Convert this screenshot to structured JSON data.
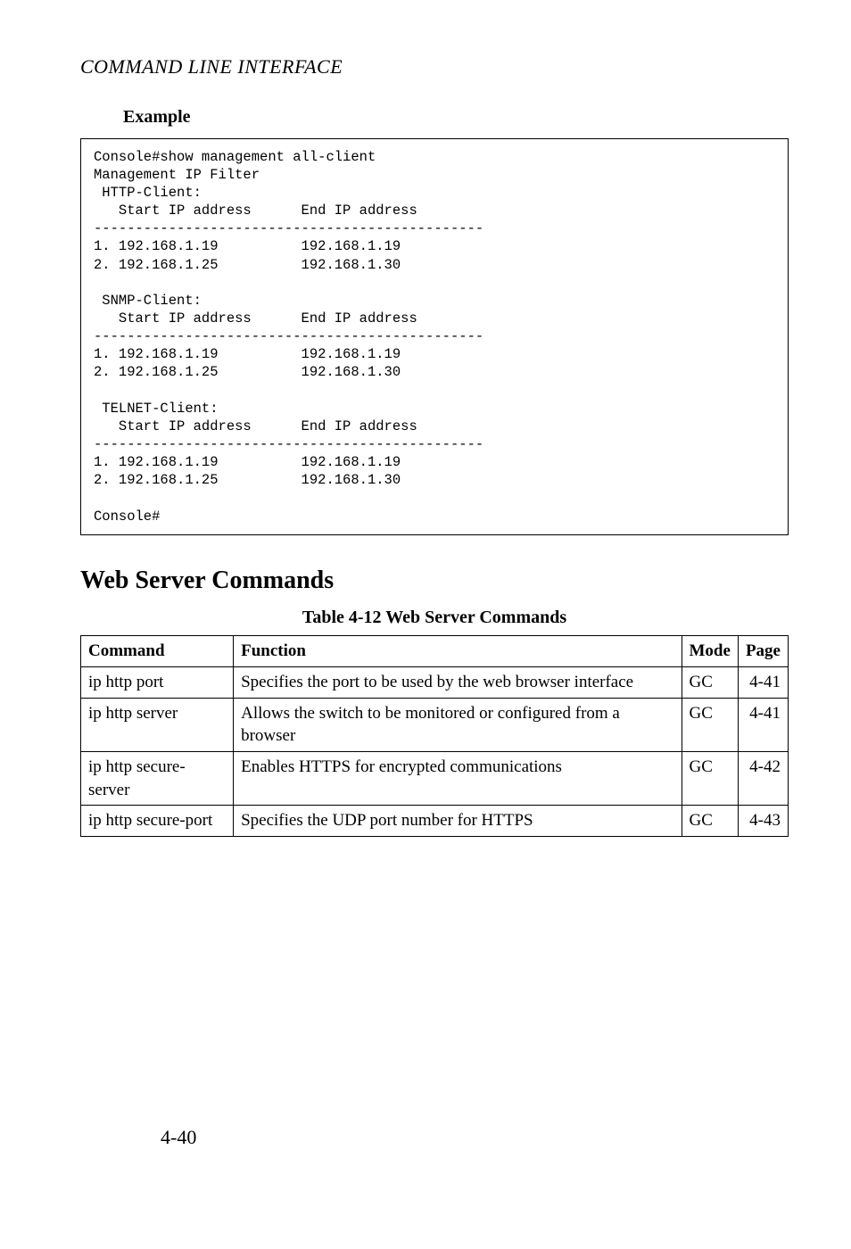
{
  "header": "COMMAND LINE INTERFACE",
  "example_label": "Example",
  "console": {
    "line1": "Console#show management all-client",
    "line2": "Management IP Filter",
    "http_client": " HTTP-Client:",
    "header_cols": "   Start IP address      End IP address",
    "rule": "-----------------------------------------------",
    "r1": "1. 192.168.1.19          192.168.1.19",
    "r2": "2. 192.168.1.25          192.168.1.30",
    "snmp_client": " SNMP-Client:",
    "telnet_client": " TELNET-Client:",
    "prompt": "Console#"
  },
  "section_title": "Web Server Commands",
  "table_caption": "Table 4-12  Web Server Commands",
  "table": {
    "h_command": "Command",
    "h_function": "Function",
    "h_mode": "Mode",
    "h_page": "Page",
    "rows": [
      {
        "cmd": "ip http port",
        "fn": "Specifies the port to be used by the web browser interface",
        "mode": "GC",
        "page": "4-41"
      },
      {
        "cmd": "ip http server",
        "fn": "Allows the switch to be monitored or configured from a browser",
        "mode": "GC",
        "page": "4-41"
      },
      {
        "cmd": "ip http secure-server",
        "fn": "Enables HTTPS for encrypted communications",
        "mode": "GC",
        "page": "4-42"
      },
      {
        "cmd": "ip http secure-port",
        "fn": "Specifies the UDP port number for HTTPS",
        "mode": "GC",
        "page": "4-43"
      }
    ]
  },
  "page_number": "4-40"
}
